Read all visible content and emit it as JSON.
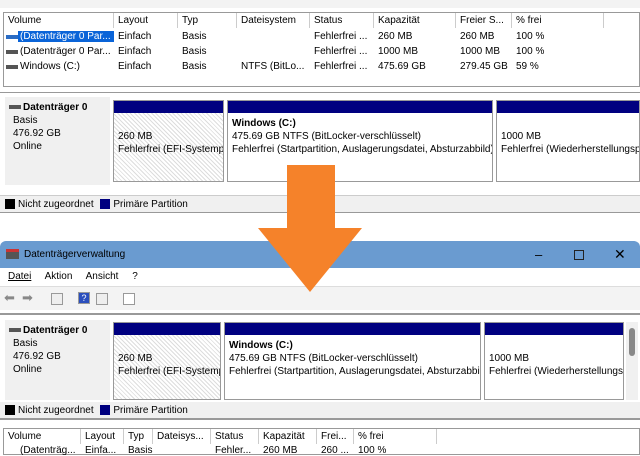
{
  "top_table": {
    "columns": [
      "Volume",
      "Layout",
      "Typ",
      "Dateisystem",
      "Status",
      "Kapazität",
      "Freier S...",
      "% frei"
    ],
    "rows": [
      [
        "(Datenträger 0 Par...",
        "Einfach",
        "Basis",
        "",
        "Fehlerfrei ...",
        "260 MB",
        "260 MB",
        "100 %"
      ],
      [
        "(Datenträger 0 Par...",
        "Einfach",
        "Basis",
        "",
        "Fehlerfrei ...",
        "1000 MB",
        "1000 MB",
        "100 %"
      ],
      [
        "Windows (C:)",
        "Einfach",
        "Basis",
        "NTFS (BitLo...",
        "Fehlerfrei ...",
        "475.69 GB",
        "279.45 GB",
        "59 %"
      ]
    ]
  },
  "disk": {
    "name": "Datenträger 0",
    "type": "Basis",
    "size": "476.92 GB",
    "state": "Online"
  },
  "top_parts": [
    {
      "title": "",
      "size": "260 MB",
      "status": "Fehlerfrei (EFI-Systempartition)"
    },
    {
      "title": "Windows  (C:)",
      "size": "475.69 GB NTFS (BitLocker-verschlüsselt)",
      "status": "Fehlerfrei (Startpartition, Auslagerungsdatei, Absturzabbild)"
    },
    {
      "title": "",
      "size": "1000 MB",
      "status": "Fehlerfrei (Wiederherstellungspartition)"
    }
  ],
  "legend": {
    "unallocated": "Nicht zugeordnet",
    "primary": "Primäre Partition"
  },
  "window": {
    "title": "Datenträgerverwaltung",
    "menu": [
      "Datei",
      "Aktion",
      "Ansicht",
      "?"
    ]
  },
  "bottom_table": {
    "columns": [
      "Volume",
      "Layout",
      "Typ",
      "Dateisys...",
      "Status",
      "Kapazität",
      "Frei...",
      "% frei"
    ],
    "row": [
      "(Datenträg...",
      "Einfa...",
      "Basis",
      "",
      "Fehler...",
      "260 MB",
      "260 ...",
      "100 %"
    ]
  },
  "colors": {
    "primary": "#000080",
    "arrow": "#f5822a",
    "titlebar": "#6a9bd0"
  }
}
